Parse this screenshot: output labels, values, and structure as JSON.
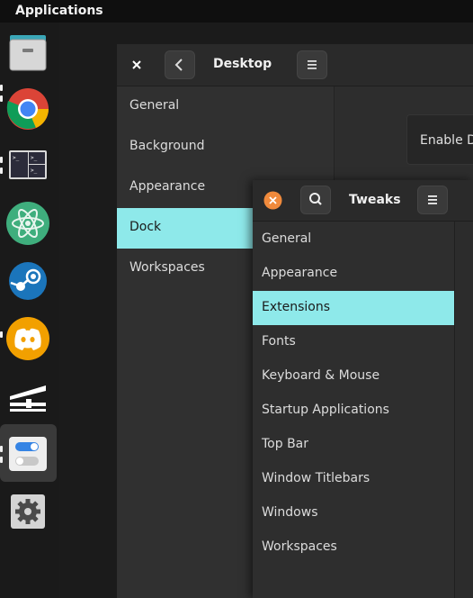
{
  "topbar": {
    "title": "Applications"
  },
  "dock": {
    "items": [
      {
        "icon": "files-icon"
      },
      {
        "icon": "chrome-icon"
      },
      {
        "icon": "terminal-icon"
      },
      {
        "icon": "atom-icon"
      },
      {
        "icon": "steam-icon"
      },
      {
        "icon": "discord-icon"
      },
      {
        "icon": "levels-icon"
      },
      {
        "icon": "tweaks-icon"
      },
      {
        "icon": "settings-icon"
      }
    ]
  },
  "settings_window": {
    "title": "Desktop",
    "sidebar": [
      {
        "label": "General"
      },
      {
        "label": "Background"
      },
      {
        "label": "Appearance"
      },
      {
        "label": "Dock",
        "selected": true
      },
      {
        "label": "Workspaces"
      }
    ],
    "content_label": "Enable D"
  },
  "tweaks_window": {
    "title": "Tweaks",
    "sidebar": [
      {
        "label": "General"
      },
      {
        "label": "Appearance"
      },
      {
        "label": "Extensions",
        "selected": true
      },
      {
        "label": "Fonts"
      },
      {
        "label": "Keyboard & Mouse"
      },
      {
        "label": "Startup Applications"
      },
      {
        "label": "Top Bar"
      },
      {
        "label": "Window Titlebars"
      },
      {
        "label": "Windows"
      },
      {
        "label": "Workspaces"
      }
    ]
  },
  "colors": {
    "accent": "#8ee9ea",
    "close_button": "#f08a3c"
  }
}
